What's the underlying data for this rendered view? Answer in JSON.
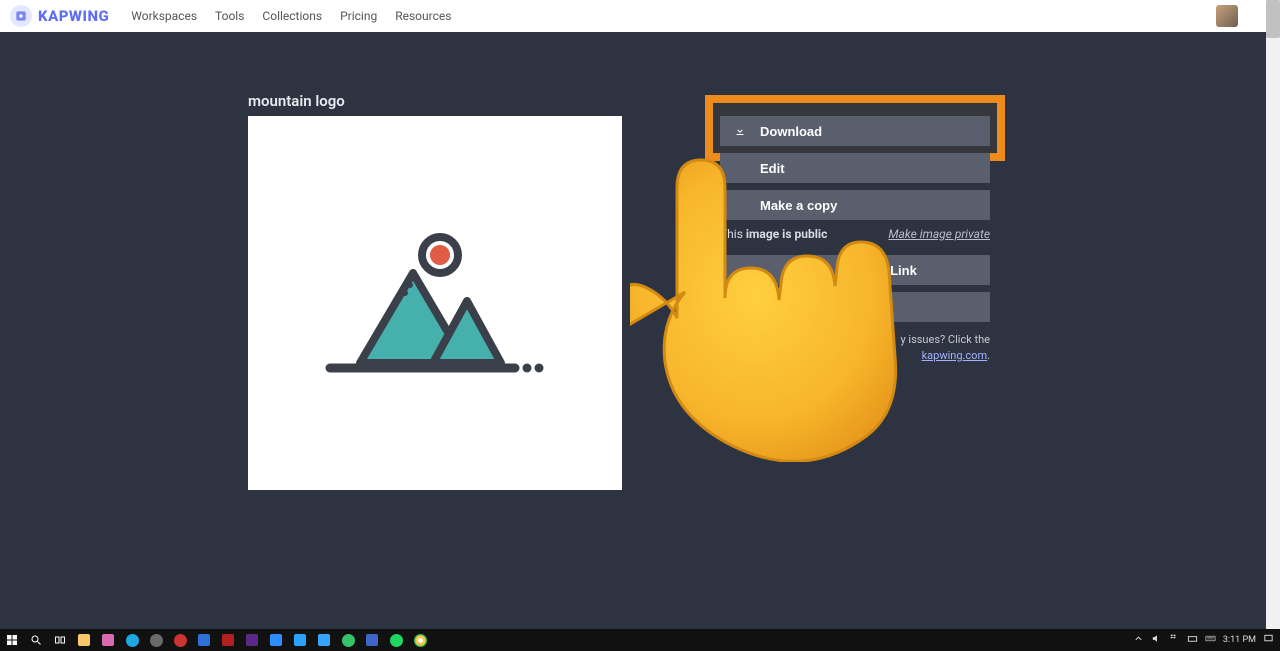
{
  "brand": "KAPWING",
  "nav": {
    "workspaces": "Workspaces",
    "tools": "Tools",
    "collections": "Collections",
    "pricing": "Pricing",
    "resources": "Resources"
  },
  "project": {
    "title": "mountain logo"
  },
  "actions": {
    "download": "Download",
    "edit": "Edit",
    "make_copy": "Make a copy",
    "copy_link": "Copy Link"
  },
  "privacy": {
    "status_prefix": "This ",
    "status_bold": "image is public",
    "make_private": "Make image private"
  },
  "help": {
    "line1": "y issues? Click the",
    "link": "kapwing.com",
    "dot": "."
  },
  "taskbar": {
    "time": "3:11 PM"
  }
}
